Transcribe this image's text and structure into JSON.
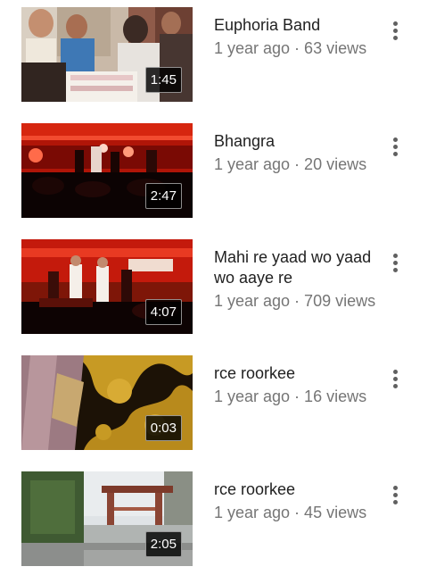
{
  "videos": [
    {
      "title": "Euphoria Band",
      "age": "1 year ago",
      "views": "63 views",
      "duration": "1:45",
      "thumbnail": "cake-cutting-icon",
      "subtitle": "1 year ago · 63 views"
    },
    {
      "title": "Bhangra",
      "age": "1 year ago",
      "views": "20 views",
      "duration": "2:47",
      "thumbnail": "red-stage-icon",
      "subtitle": "1 year ago · 20 views"
    },
    {
      "title": "Mahi re yaad wo yaad wo aaye re",
      "age": "1 year ago",
      "views": "709 views",
      "duration": "4:07",
      "thumbnail": "stage-performance-icon",
      "subtitle": "1 year ago · 709 views"
    },
    {
      "title": "rce roorkee",
      "age": "1 year ago",
      "views": "16 views",
      "duration": "0:03",
      "thumbnail": "gold-pattern-icon",
      "subtitle": "1 year ago · 16 views"
    },
    {
      "title": "rce roorkee",
      "age": "1 year ago",
      "views": "45 views",
      "duration": "2:05",
      "thumbnail": "campus-gate-icon",
      "subtitle": "1 year ago · 45 views"
    }
  ],
  "colors": {
    "title": "#212121",
    "subtitle": "#757575",
    "menu": "#606060"
  }
}
